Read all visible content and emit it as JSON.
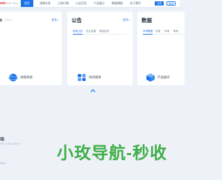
{
  "header": {
    "logo": "ads",
    "logo_sub": "WE LEA",
    "nav": [
      "首页",
      "领域头条",
      "土地行情",
      "公告百页",
      "产品展示",
      "数据情报",
      "关于我们"
    ],
    "active_index": 0,
    "login": "注册",
    "register": "登录"
  },
  "cards": [
    {
      "title": "s",
      "en": "ENES",
      "more": "更多»",
      "tabs": [],
      "feature": "地图系统"
    },
    {
      "title": "公告",
      "en": "",
      "more": "更多»",
      "tabs": [
        "拍卖公告",
        "出让结果",
        "规划信息"
      ],
      "feature": "地块搜索"
    },
    {
      "title": "数据",
      "en": "",
      "more": "",
      "tabs": [
        "市场数据",
        "月报",
        "年报",
        "案例"
      ],
      "feature": "产品展示"
    }
  ],
  "bottom": {
    "left_title": "动",
    "left_en": "HH THE EARTH",
    "left_sub": "RING",
    "watermark": "小玫导航-秒收"
  },
  "colors": {
    "accent": "#1a73e8",
    "watermark": "#3fae48",
    "background": "#eef2f8"
  }
}
